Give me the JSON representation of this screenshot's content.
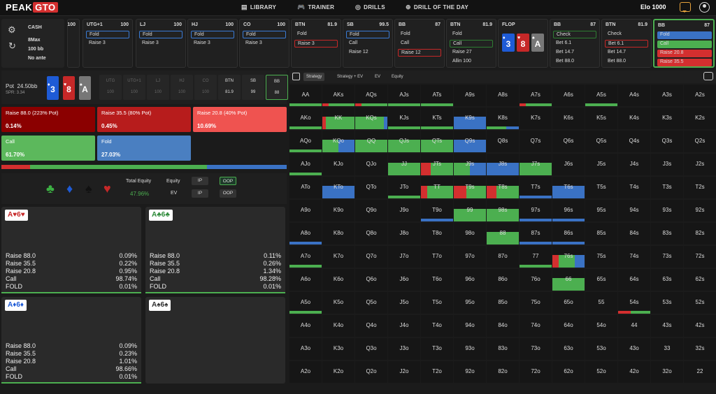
{
  "app": {
    "logo_left": "PEAK",
    "logo_right": "GTO"
  },
  "nav": {
    "library": "LIBRARY",
    "trainer": "TRAINER",
    "drills": "DRILLS",
    "dotd": "DRILL OF THE DAY",
    "elo": "Elo 1000"
  },
  "game": {
    "type": "CASH",
    "format": "8Max",
    "stack": "100 bb",
    "ante": "No ante"
  },
  "seats": [
    {
      "pos": "",
      "stack": "100",
      "actions": []
    },
    {
      "pos": "UTG+1",
      "stack": "100",
      "actions": [
        "Fold",
        "Raise 3"
      ]
    },
    {
      "pos": "LJ",
      "stack": "100",
      "actions": [
        "Fold",
        "Raise 3"
      ]
    },
    {
      "pos": "HJ",
      "stack": "100",
      "actions": [
        "Fold",
        "Raise 3"
      ]
    },
    {
      "pos": "CO",
      "stack": "100",
      "actions": [
        "Fold",
        "Raise 3"
      ]
    },
    {
      "pos": "BTN",
      "stack": "81.9",
      "actions": [
        "Fold",
        "Raise 3"
      ]
    },
    {
      "pos": "SB",
      "stack": "99.5",
      "actions": [
        "Fold",
        "Call",
        "Raise 12"
      ]
    },
    {
      "pos": "BB",
      "stack": "87",
      "actions": [
        "Fold",
        "Call",
        "Raise 12"
      ]
    },
    {
      "pos": "BTN",
      "stack": "81.9",
      "actions": [
        "Fold",
        "Call",
        "Raise 27",
        "Allin 100"
      ]
    },
    {
      "pos": "FLOP",
      "stack": "",
      "actions": []
    },
    {
      "pos": "BB",
      "stack": "87",
      "actions": [
        "Check",
        "Bet 6.1",
        "Bet 14.7",
        "Bet 88.0"
      ]
    },
    {
      "pos": "BTN",
      "stack": "81.9",
      "actions": [
        "Check",
        "Bet 6.1",
        "Bet 14.7",
        "Bet 88.0"
      ]
    },
    {
      "pos": "BB",
      "stack": "87",
      "actions": [
        "Fold",
        "Call",
        "Raise 20.8",
        "Raise 35.5"
      ]
    }
  ],
  "flop_cards": [
    {
      "rank": "3",
      "suit": "♦"
    },
    {
      "rank": "8",
      "suit": "♥"
    },
    {
      "rank": "A",
      "suit": "♠"
    }
  ],
  "pot": {
    "label": "Pot",
    "value": "24.50bb",
    "spr": "SPR: 3.34"
  },
  "positions": [
    {
      "p": "UTG",
      "s": "100"
    },
    {
      "p": "UTG+1",
      "s": "100"
    },
    {
      "p": "LJ",
      "s": "100"
    },
    {
      "p": "HJ",
      "s": "100"
    },
    {
      "p": "CO",
      "s": "100"
    },
    {
      "p": "BTN",
      "s": "81.9"
    },
    {
      "p": "SB",
      "s": "99"
    },
    {
      "p": "BB",
      "s": "88"
    }
  ],
  "strategy": [
    {
      "label": "Raise 88.0 (223% Pot)",
      "pct": "0.14%",
      "color": "#8b0000"
    },
    {
      "label": "Raise 35.5 (80% Pot)",
      "pct": "0.45%",
      "color": "#b71c1c"
    },
    {
      "label": "Raise 20.8 (40% Pot)",
      "pct": "10.69%",
      "color": "#ef5350"
    },
    {
      "label": "Call",
      "pct": "61.70%",
      "color": "#5cb85c"
    },
    {
      "label": "Fold",
      "pct": "27.03%",
      "color": "#4a7fc1"
    }
  ],
  "freq_segments": [
    {
      "frac": 0.1,
      "color": "#d32f2f"
    },
    {
      "frac": 0.62,
      "color": "#4caf50"
    },
    {
      "frac": 0.28,
      "color": "#3a72c4"
    }
  ],
  "equity": {
    "total_label": "Total Equity",
    "total": "47.96%",
    "equity_label": "Equity",
    "ev_label": "EV",
    "ip": "IP",
    "oop": "OOP"
  },
  "combos": [
    {
      "hand": "A♥6♥",
      "c": "#c62828",
      "rows": [
        [
          "Raise 88.0",
          "0.09%"
        ],
        [
          "Raise 35.5",
          "0.22%"
        ],
        [
          "Raise 20.8",
          "0.95%"
        ],
        [
          "Call",
          "98.74%"
        ],
        [
          "FOLD",
          "0.01%"
        ]
      ]
    },
    {
      "hand": "A♣6♣",
      "c": "#2e8b3a",
      "rows": [
        [
          "Raise 88.0",
          "0.11%"
        ],
        [
          "Raise 35.5",
          "0.26%"
        ],
        [
          "Raise 20.8",
          "1.34%"
        ],
        [
          "Call",
          "98.28%"
        ],
        [
          "FOLD",
          "0.01%"
        ]
      ]
    },
    {
      "hand": "A♦6♦",
      "c": "#1e5bd6",
      "rows": [
        [
          "Raise 88.0",
          "0.09%"
        ],
        [
          "Raise 35.5",
          "0.23%"
        ],
        [
          "Raise 20.8",
          "1.01%"
        ],
        [
          "Call",
          "98.66%"
        ],
        [
          "FOLD",
          "0.01%"
        ]
      ]
    },
    {
      "hand": "A♠6♠",
      "c": "#333",
      "rows": []
    }
  ],
  "tabs": [
    "Strategy",
    "Strategy + EV",
    "EV",
    "Equity"
  ],
  "ranks": [
    "A",
    "K",
    "Q",
    "J",
    "T",
    "9",
    "8",
    "7",
    "6",
    "5",
    "4",
    "3",
    "2"
  ]
}
